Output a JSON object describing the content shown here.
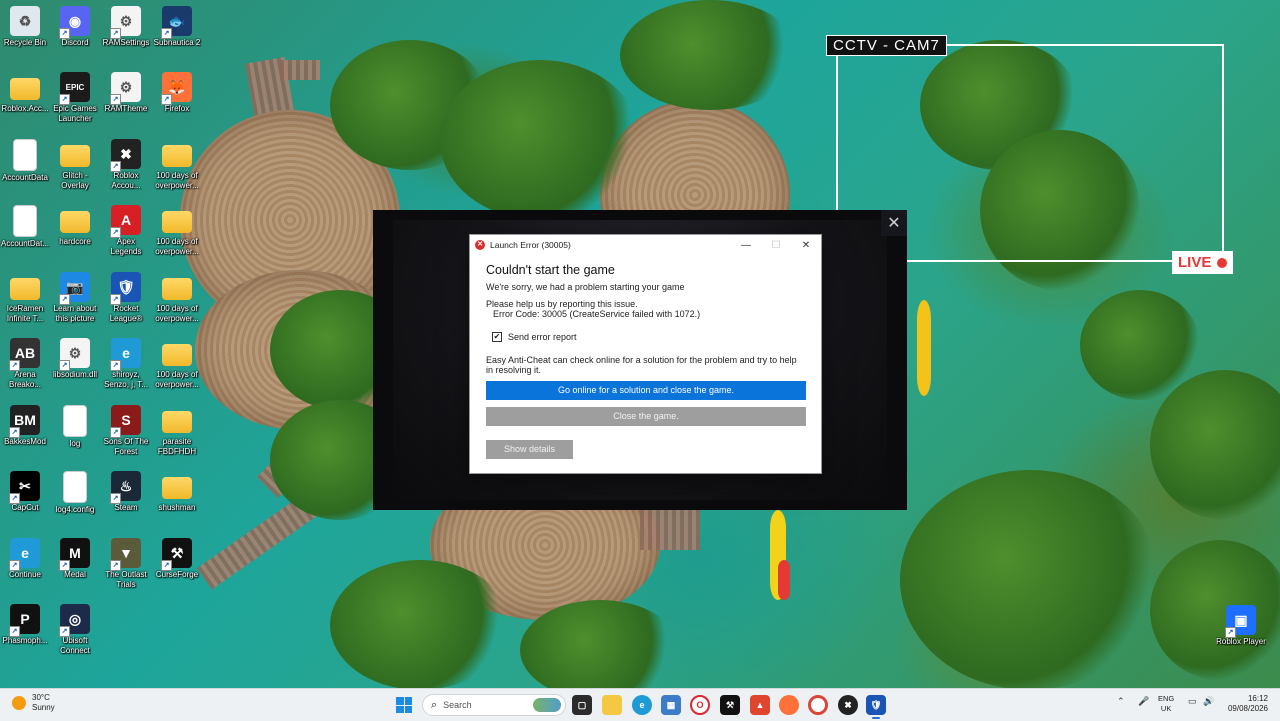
{
  "desktop": {
    "icons": [
      {
        "label": "Recycle Bin",
        "icon": "recycle-bin-icon",
        "color": "#dfe7ef",
        "glyph": "♻"
      },
      {
        "label": "Discord",
        "icon": "discord-icon",
        "color": "#5865f2",
        "glyph": "◉"
      },
      {
        "label": "RAMSettings",
        "icon": "settings-file-icon",
        "color": "#f4f4f4",
        "glyph": "⚙"
      },
      {
        "label": "Subnautica 2",
        "icon": "subnautica-icon",
        "color": "#1a3a6b",
        "glyph": "🐟"
      },
      {
        "label": "Roblox.Acc...",
        "icon": "folder-icon",
        "color": "#f5c842",
        "glyph": ""
      },
      {
        "label": "Epic Games Launcher",
        "icon": "epic-games-icon",
        "color": "#1b1b1b",
        "glyph": "EPIC"
      },
      {
        "label": "RAMTheme",
        "icon": "settings-file-icon",
        "color": "#f4f4f4",
        "glyph": "⚙"
      },
      {
        "label": "Firefox",
        "icon": "firefox-icon",
        "color": "#ff7139",
        "glyph": "🦊"
      },
      {
        "label": "AccountData",
        "icon": "document-icon",
        "color": "#ffffff",
        "glyph": ""
      },
      {
        "label": "Glitch - Overlay",
        "icon": "folder-icon",
        "color": "#f5c842",
        "glyph": ""
      },
      {
        "label": "Roblox Accou...",
        "icon": "roblox-account-icon",
        "color": "#222222",
        "glyph": "✖"
      },
      {
        "label": "100 days of overpower...",
        "icon": "folder-icon",
        "color": "#f5c842",
        "glyph": ""
      },
      {
        "label": "AccountDat...",
        "icon": "document-icon",
        "color": "#ffffff",
        "glyph": ""
      },
      {
        "label": "hardcore",
        "icon": "folder-icon",
        "color": "#f5c842",
        "glyph": ""
      },
      {
        "label": "Apex Legends",
        "icon": "apex-legends-icon",
        "color": "#d81f26",
        "glyph": "A"
      },
      {
        "label": "100 days of overpower...",
        "icon": "folder-icon",
        "color": "#f5c842",
        "glyph": ""
      },
      {
        "label": "IceRamen Infinite T...",
        "icon": "folder-icon",
        "color": "#f5c842",
        "glyph": ""
      },
      {
        "label": "Learn about this picture",
        "icon": "learn-picture-icon",
        "color": "#1e88e5",
        "glyph": "📷"
      },
      {
        "label": "Rocket League®",
        "icon": "rocket-league-icon",
        "color": "#1a55b5",
        "glyph": "🛡"
      },
      {
        "label": "100 days of overpower...",
        "icon": "folder-icon",
        "color": "#f5c842",
        "glyph": ""
      },
      {
        "label": "Arena Breako...",
        "icon": "arena-breakout-icon",
        "color": "#333333",
        "glyph": "AB"
      },
      {
        "label": "libsodium.dll",
        "icon": "dll-file-icon",
        "color": "#f4f4f4",
        "glyph": "⚙"
      },
      {
        "label": "shiroyz, Senzo, j, T...",
        "icon": "edge-shortcut-icon",
        "color": "#1f9ad6",
        "glyph": "e"
      },
      {
        "label": "100 days of overpower...",
        "icon": "folder-icon",
        "color": "#f5c842",
        "glyph": ""
      },
      {
        "label": "BakkesMod",
        "icon": "bakkesmod-icon",
        "color": "#222222",
        "glyph": "BM"
      },
      {
        "label": "log",
        "icon": "text-file-icon",
        "color": "#ffffff",
        "glyph": ""
      },
      {
        "label": "Sons Of The Forest",
        "icon": "sons-of-the-forest-icon",
        "color": "#8b1a1a",
        "glyph": "S"
      },
      {
        "label": "parasite FBDFHDH",
        "icon": "folder-icon",
        "color": "#f5c842",
        "glyph": ""
      },
      {
        "label": "CapCut",
        "icon": "capcut-icon",
        "color": "#000000",
        "glyph": "✂"
      },
      {
        "label": "log4.config",
        "icon": "document-icon",
        "color": "#ffffff",
        "glyph": ""
      },
      {
        "label": "Steam",
        "icon": "steam-icon",
        "color": "#1b2838",
        "glyph": "♨"
      },
      {
        "label": "shushman",
        "icon": "folder-icon",
        "color": "#f5c842",
        "glyph": ""
      },
      {
        "label": "Continue",
        "icon": "edge-continue-icon",
        "color": "#1f9ad6",
        "glyph": "e"
      },
      {
        "label": "Medal",
        "icon": "medal-icon",
        "color": "#111111",
        "glyph": "M"
      },
      {
        "label": "The Outlast Trials",
        "icon": "outlast-trials-icon",
        "color": "#5b5a3a",
        "glyph": "▼"
      },
      {
        "label": "CurseForge",
        "icon": "curseforge-icon",
        "color": "#111111",
        "glyph": "⚒"
      },
      {
        "label": "Phasmoph...",
        "icon": "phasmophobia-icon",
        "color": "#111111",
        "glyph": "P"
      },
      {
        "label": "Ubisoft Connect",
        "icon": "ubisoft-icon",
        "color": "#1e2a4a",
        "glyph": "◎"
      }
    ],
    "right_icon": {
      "label": "Roblox Player",
      "icon": "roblox-player-icon",
      "color": "#1e6fff",
      "glyph": "▣"
    }
  },
  "cctv": {
    "title": "CCTV - CAM7",
    "live": "LIVE"
  },
  "game_window": {
    "close": "✕"
  },
  "dialog": {
    "title": "Launch Error (30005)",
    "minimize": "—",
    "maximize": "☐",
    "close": "✕",
    "heading": "Couldn't start the game",
    "sorry": "We're sorry, we had a problem starting your game",
    "report_prompt": "Please help us by reporting this issue.",
    "error_code": "Error Code: 30005 (CreateService failed with 1072.)",
    "send_report_label": "Send error report",
    "send_report_checked": true,
    "eac_text": "Easy Anti-Cheat can check online for a solution for the problem and try to help in resolving it.",
    "go_online_button": "Go online for a solution and close the game.",
    "close_game_button": "Close the game.",
    "show_details_button": "Show details"
  },
  "taskbar": {
    "weather_temp": "30°C",
    "weather_desc": "Sunny",
    "search_placeholder": "Search",
    "language_line1": "ENG",
    "language_line2": "UK",
    "time": "16:12",
    "date": "09/08/2026"
  },
  "colors": {
    "primary_button": "#0a74da",
    "gray_button": "#9e9e9e",
    "live_red": "#e53935"
  }
}
